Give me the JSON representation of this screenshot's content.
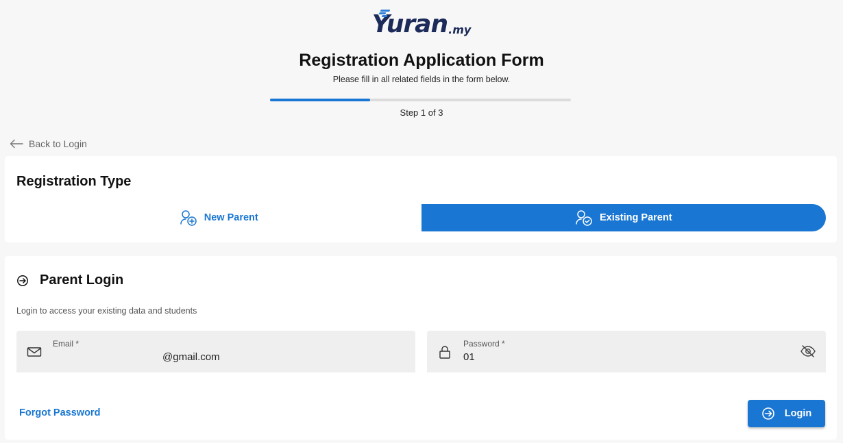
{
  "header": {
    "logo_text": "Yuran",
    "logo_suffix": ".my",
    "title": "Registration Application Form",
    "subtitle": "Please fill in all related fields in the form below.",
    "progress_fraction": 0.333,
    "step_text": "Step 1 of 3"
  },
  "nav": {
    "back_label": "Back to Login"
  },
  "registration_type": {
    "title": "Registration Type",
    "options": [
      {
        "label": "New Parent",
        "selected": false,
        "icon": "user-plus-icon"
      },
      {
        "label": "Existing Parent",
        "selected": true,
        "icon": "user-check-icon"
      }
    ]
  },
  "login": {
    "title": "Parent Login",
    "description": "Login to access your existing data and students",
    "email": {
      "label": "Email *",
      "value": "@gmail.com"
    },
    "password": {
      "label": "Password *",
      "value": "01"
    },
    "forgot_label": "Forgot Password",
    "login_label": "Login"
  },
  "colors": {
    "accent": "#1976d2",
    "background": "#f7f7f7",
    "field_background": "#efefef"
  }
}
